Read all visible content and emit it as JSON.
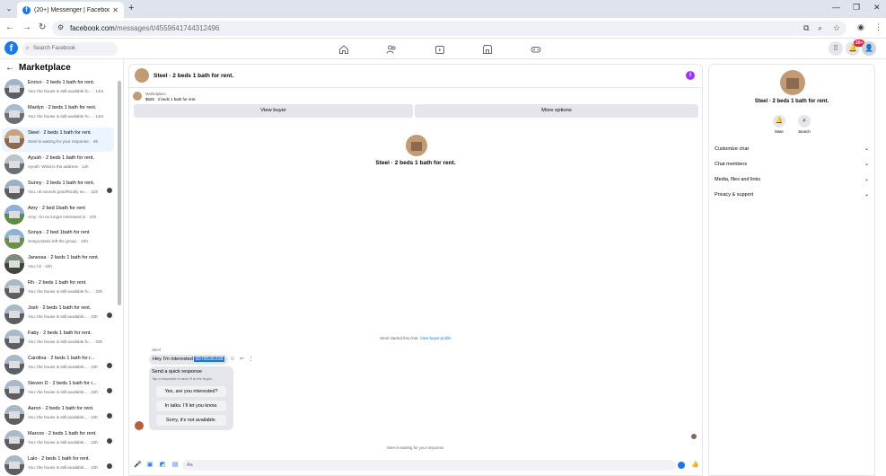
{
  "browser": {
    "tab_title": "(20+) Messenger | Facebook",
    "url_host": "facebook.com",
    "url_path": "/messages/t/4559641744312496"
  },
  "fb": {
    "search_placeholder": "Search Facebook",
    "notif_count": "20+"
  },
  "sidebar": {
    "title": "Marketplace",
    "conversations": [
      {
        "name": "Enrico · 2 beds 1 bath for rent.",
        "preview": "You: the house is still available fo... · 14m",
        "dot": false
      },
      {
        "name": "Marilyn · 2 beds 1 bath for rent.",
        "preview": "You: the house is still available fo... · 14m",
        "dot": false
      },
      {
        "name": "Steel · 2 beds 1 bath for rent.",
        "preview": "Steel is waiting for your response. · 9h",
        "dot": false
      },
      {
        "name": "Ayush · 2 beds 1 bath for rent.",
        "preview": "Ayush: What is the address · 14h",
        "dot": false
      },
      {
        "name": "Sunny · 2 beds 1 bath for rent.",
        "preview": "You: ok sounds good!Kindly se... · 22h",
        "dot": true
      },
      {
        "name": "Amy · 2 bed 1bath for rent",
        "preview": "Amy: I'm no longer interested in · 22h",
        "dot": false
      },
      {
        "name": "Sonya · 2 bed 1bath for rent",
        "preview": "Sonya Marie left the group. · 22h",
        "dot": false
      },
      {
        "name": "Janessa · 2 beds 1 bath for rent.",
        "preview": "You: hi! · 22h",
        "dot": false
      },
      {
        "name": "Rh · 2 beds 1 bath for rent.",
        "preview": "You: the house is still available fo... · 23h",
        "dot": false
      },
      {
        "name": "Josh · 2 beds 1 bath for rent.",
        "preview": "You: the house is still available... · 23h",
        "dot": true
      },
      {
        "name": "Faby · 2 beds 1 bath for rent.",
        "preview": "You: the house is still available fo... · 23h",
        "dot": false
      },
      {
        "name": "Carolina · 2 beds 1 bath for r...",
        "preview": "You: the house is still available... · 23h",
        "dot": true
      },
      {
        "name": "Steven D · 2 beds 1 bath for r...",
        "preview": "You: the house is still available... · 23h",
        "dot": true
      },
      {
        "name": "Aaron · 2 beds 1 bath for rent.",
        "preview": "You: the house is still available... · 23h",
        "dot": true
      },
      {
        "name": "Marcos · 2 beds 1 bath for rent.",
        "preview": "You: the house is still available... · 23h",
        "dot": true
      },
      {
        "name": "Lalo · 2 beds 1 bath for rent.",
        "preview": "You: the house is still available... · 23h",
        "dot": true
      }
    ]
  },
  "chat": {
    "title": "Steel · 2 beds 1 bath for rent.",
    "marketplace_label": "Marketplace",
    "listing_price": "$625 · 2 beds 1 bath for rent.",
    "view_buyer": "View buyer",
    "more_options": "More options",
    "intro_name": "Steel · 2 beds 1 bath for rent.",
    "started_text": "Steel started this chat.",
    "view_buyer_profile": "View buyer profile",
    "sender": "Steel",
    "message_text": "Hey I'm interested ",
    "message_highlight": "9078536208",
    "quick_title": "Send a quick response",
    "quick_sub": "Tap a response to send it to the buyer.",
    "quick_replies": [
      "Yes, are you interested?",
      "In talks. I'll let you know.",
      "Sorry, it's not available."
    ],
    "waiting_text": "Steel is waiting for your response.",
    "composer_placeholder": "Aa"
  },
  "right_panel": {
    "name": "Steel · 2 beds 1 bath for rent.",
    "mute_label": "Mute",
    "search_label": "Search",
    "rows": [
      "Customize chat",
      "Chat members",
      "Media, files and links",
      "Privacy & support"
    ]
  },
  "colors": {
    "fb_blue": "#1877f2",
    "info_purple": "#a033ff",
    "active_row": "#ebf5ff"
  }
}
